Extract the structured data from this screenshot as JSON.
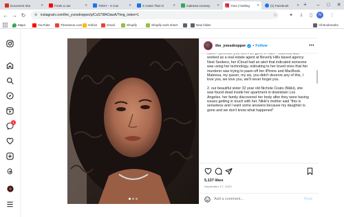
{
  "browser": {
    "tabs": [
      {
        "label": "Document sha",
        "color": "#d93025",
        "active": false
      },
      {
        "label": "Freek a cas",
        "color": "#ff0000",
        "active": false
      },
      {
        "label": "TWXY - X Cas",
        "color": "#1a73e8",
        "active": false
      },
      {
        "label": "X Casts That Vi",
        "color": "#1a73e8",
        "active": false
      },
      {
        "label": "maleesa mooney",
        "color": "#34a853",
        "active": false
      },
      {
        "label": "Yves | holding",
        "color": "#e1306c",
        "active": true
      },
      {
        "label": "(1) Facebook",
        "color": "#1877f2",
        "active": false
      }
    ],
    "url": "instagram.com/the_yvesdropper/p/CsS79fAOawA/?img_index=1",
    "profile_initial": "N"
  },
  "bookmarks": [
    {
      "label": "Maps",
      "color": "#34a853"
    },
    {
      "label": "YouTube",
      "color": "#ff0000"
    },
    {
      "label": "Theeasrue.com",
      "color": "#ea4335"
    },
    {
      "label": "Gdrive",
      "color": "#fbbc04"
    },
    {
      "label": "Gmail",
      "color": "#ea4335"
    },
    {
      "label": "Shopify",
      "color": "#95bf47"
    },
    {
      "label": "Shopify work sheet",
      "color": "#95bf47"
    },
    {
      "label": "",
      "color": "#5f6368"
    },
    {
      "label": "New folder",
      "color": "#5f6368"
    }
  ],
  "all_bookmarks": "All Bookmarks",
  "sidebar": {
    "notification_count": "1"
  },
  "post": {
    "username": "the_yvesdropper",
    "follow": "Follow",
    "separator": "•",
    "caption": [
      "sister. I promise you won't be gone in vain.\" Maleesa also worked as a real estate agent at Beverly Hills based agency Nest Seekers, her iCloud had an alert that indicated someone was using her technology, indicating to her loved ones that her murderer was trying to pawn off her iPhone and MacBook. Maleesa, my queen, my sis, you didn't deserve any of this, I love you, we love you, we'll never forget you.",
      "2. our beautiful sister 32 year old Nichole Coats (Nikki), she was found dead inside her apartment in downtown Los Angeles. her family discovered her body after they were having issues getting in touch with her. Nikki's mother said \"this is senseless and I want some answers because my daughter is gone and we don't know what happened\""
    ],
    "likes": "5,137 likes",
    "date": "September 17, 2023",
    "comment_placeholder": "Add a comment...",
    "post_button": "Post"
  }
}
